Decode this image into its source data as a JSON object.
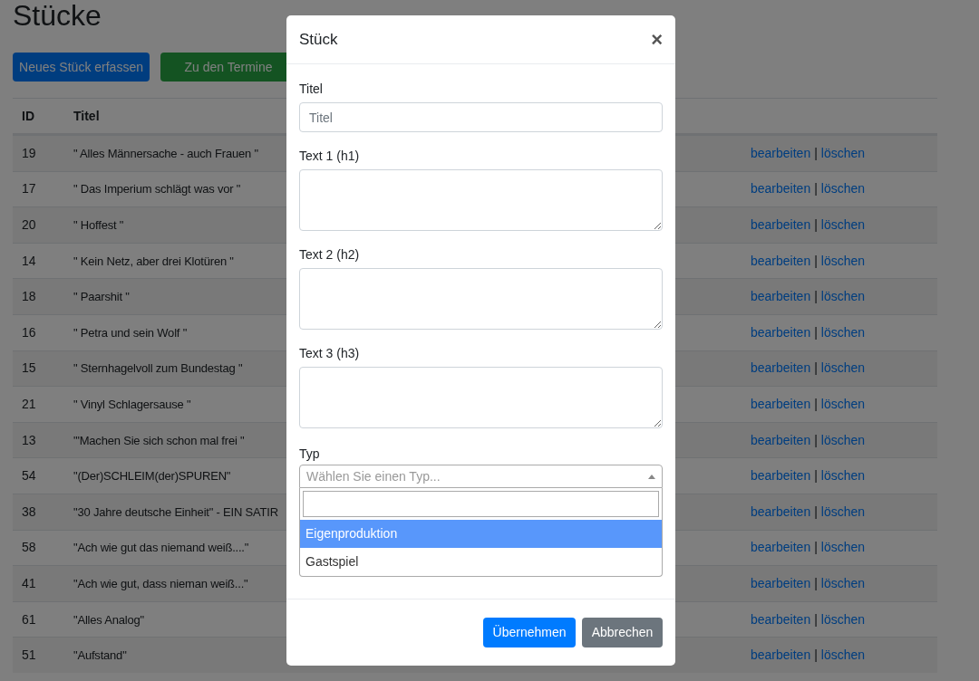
{
  "page": {
    "title": "Stücke",
    "buttons": [
      {
        "label": "Neues Stück erfassen",
        "kind": "primary"
      },
      {
        "label": "Zu den Termine",
        "kind": "success"
      }
    ]
  },
  "table": {
    "columns": [
      "ID",
      "Titel"
    ],
    "rows": [
      {
        "id": "19",
        "title": "\" Alles Männersache - auch Frauen \"",
        "edit": "bearbeiten",
        "separator": "|",
        "delete": "löschen"
      },
      {
        "id": "17",
        "title": "\" Das Imperium schlägt was vor \"",
        "edit": "bearbeiten",
        "separator": "|",
        "delete": "löschen"
      },
      {
        "id": "20",
        "title": "\" Hoffest \"",
        "edit": "bearbeiten",
        "separator": "|",
        "delete": "löschen"
      },
      {
        "id": "14",
        "title": "\" Kein Netz, aber drei Klotüren \"",
        "edit": "bearbeiten",
        "separator": "|",
        "delete": "löschen"
      },
      {
        "id": "18",
        "title": "\" Paarshit \"",
        "edit": "bearbeiten",
        "separator": "|",
        "delete": "löschen"
      },
      {
        "id": "16",
        "title": "\" Petra und sein Wolf \"",
        "edit": "bearbeiten",
        "separator": "|",
        "delete": "löschen"
      },
      {
        "id": "15",
        "title": "\" Sternhagelvoll zum Bundestag \"",
        "edit": "bearbeiten",
        "separator": "|",
        "delete": "löschen"
      },
      {
        "id": "21",
        "title": "\" Vinyl Schlagersause \"",
        "edit": "bearbeiten",
        "separator": "|",
        "delete": "löschen"
      },
      {
        "id": "13",
        "title": "\"'Machen Sie sich schon mal frei \"",
        "edit": "bearbeiten",
        "separator": "|",
        "delete": "löschen"
      },
      {
        "id": "54",
        "title": "\"(Der)SCHLEIM(der)SPUREN\"",
        "edit": "bearbeiten",
        "separator": "|",
        "delete": "löschen"
      },
      {
        "id": "38",
        "title": "\"30 Jahre deutsche Einheit\" - EIN SATIR",
        "edit": "bearbeiten",
        "separator": "|",
        "delete": "löschen"
      },
      {
        "id": "58",
        "title": "\"Ach wie gut das niemand weiß....\"",
        "edit": "bearbeiten",
        "separator": "|",
        "delete": "löschen"
      },
      {
        "id": "41",
        "title": "\"Ach wie gut, dass nieman weiß...\"",
        "edit": "bearbeiten",
        "separator": "|",
        "delete": "löschen"
      },
      {
        "id": "61",
        "title": "\"Alles Analog\"",
        "edit": "bearbeiten",
        "separator": "|",
        "delete": "löschen"
      },
      {
        "id": "51",
        "title": "\"Aufstand\"",
        "edit": "bearbeiten",
        "separator": "|",
        "delete": "löschen"
      }
    ]
  },
  "modal": {
    "title": "Stück",
    "close": "×",
    "fields": [
      {
        "label": "Titel",
        "kind": "input",
        "placeholder": "Titel"
      },
      {
        "label": "Text 1 (h1)",
        "kind": "textarea"
      },
      {
        "label": "Text 2 (h2)",
        "kind": "textarea"
      },
      {
        "label": "Text 3 (h3)",
        "kind": "textarea"
      }
    ],
    "select": {
      "label": "Typ",
      "placeholder": "Wählen Sie einen Typ...",
      "expanded": true,
      "options": [
        {
          "label": "Eigenproduktion",
          "selected": true
        },
        {
          "label": "Gastspiel",
          "selected": false
        }
      ]
    },
    "buttons": [
      {
        "label": "Übernehmen",
        "kind": "primary"
      },
      {
        "label": "Abbrechen",
        "kind": "secondary"
      }
    ]
  }
}
